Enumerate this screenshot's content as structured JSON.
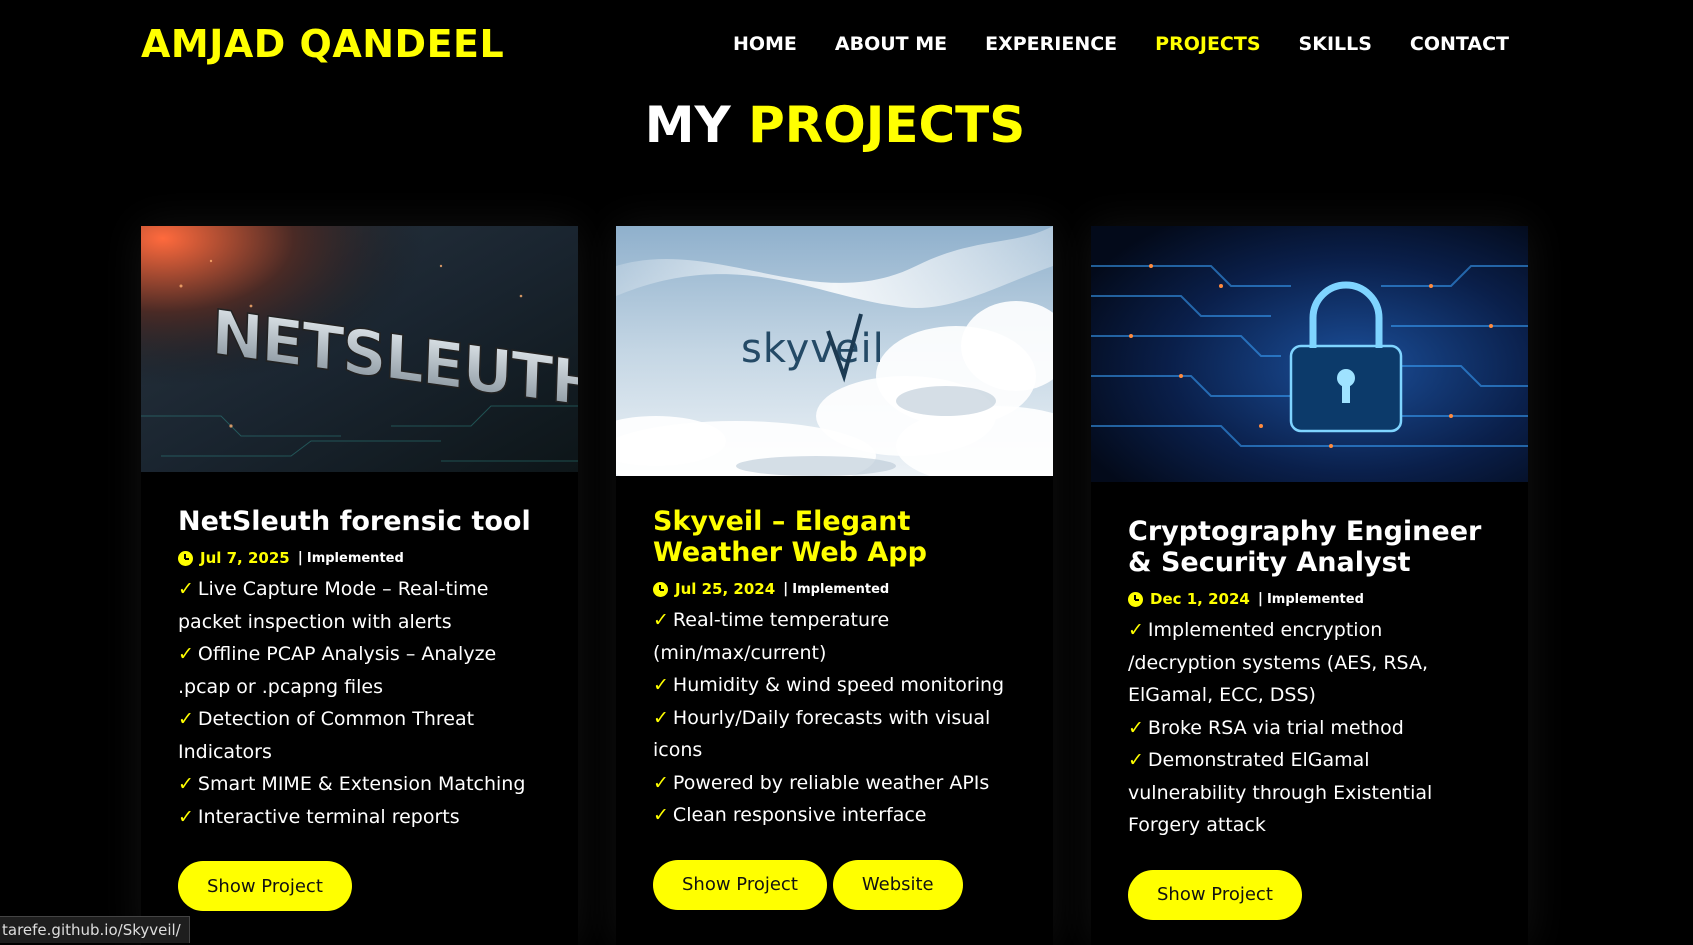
{
  "site": {
    "logo": "AMJAD QANDEEL"
  },
  "nav": [
    {
      "label": "HOME",
      "active": false
    },
    {
      "label": "ABOUT ME",
      "active": false
    },
    {
      "label": "EXPERIENCE",
      "active": false
    },
    {
      "label": "PROJECTS",
      "active": true
    },
    {
      "label": "SKILLS",
      "active": false
    },
    {
      "label": "CONTACT",
      "active": false
    }
  ],
  "section": {
    "title_plain": "MY",
    "title_accent": "PROJECTS"
  },
  "projects": [
    {
      "image_text": "NETSLEUTH",
      "title": "NetSleuth forensic tool",
      "date": "Jul 7, 2025",
      "status": "Implemented",
      "features": [
        "Live Capture Mode – Real-time packet inspection with alerts",
        "Offline PCAP Analysis – Analyze .pcap or .pcapng files",
        "Detection of Common Threat Indicators",
        "Smart MIME & Extension Matching",
        "Interactive terminal reports"
      ],
      "buttons": [
        "Show Project"
      ]
    },
    {
      "image_text": "skyveil",
      "title": "Skyveil – Elegant Weather Web App",
      "date": "Jul 25, 2024",
      "status": "Implemented",
      "features": [
        "Real-time temperature (min/max/current)",
        "Humidity & wind speed monitoring",
        "Hourly/Daily forecasts with visual icons",
        "Powered by reliable weather APIs",
        "Clean responsive interface"
      ],
      "buttons": [
        "Show Project",
        "Website"
      ]
    },
    {
      "image_text": "",
      "title": "Cryptography Engineer & Security Analyst",
      "date": "Dec 1, 2024",
      "status": "Implemented",
      "features": [
        "Implemented encryption /decryption systems (AES, RSA, ElGamal, ECC, DSS)",
        "Broke RSA via trial method",
        "Demonstrated ElGamal vulnerability through Existential Forgery attack"
      ],
      "buttons": [
        "Show Project"
      ]
    }
  ],
  "check_glyph": "✓",
  "separator": "|",
  "status_bar": {
    "url": "tarefe.github.io/Skyveil/"
  },
  "colors": {
    "accent": "#ffff00",
    "background": "#000000",
    "text": "#ffffff"
  }
}
